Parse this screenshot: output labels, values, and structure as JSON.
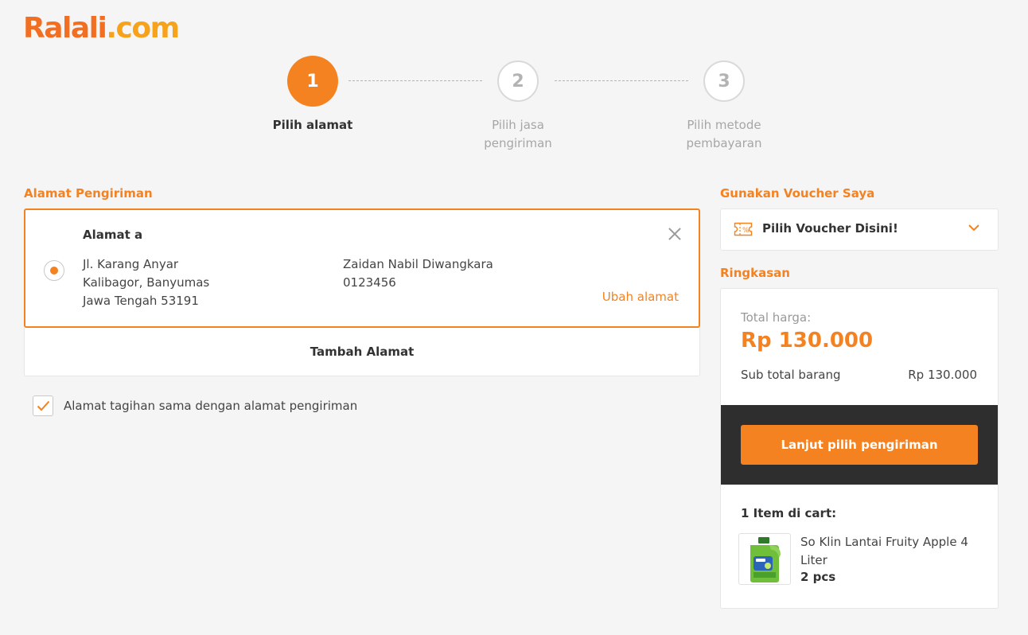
{
  "brand": {
    "name_main": "Ralali",
    "name_domain": ".com"
  },
  "stepper": {
    "steps": [
      {
        "number": "1",
        "label": "Pilih alamat"
      },
      {
        "number": "2",
        "label_line1": "Pilih jasa",
        "label_line2": "pengiriman"
      },
      {
        "number": "3",
        "label_line1": "Pilih metode",
        "label_line2": "pembayaran"
      }
    ],
    "active_step": 1
  },
  "shipping": {
    "section_title": "Alamat Pengiriman",
    "address": {
      "name": "Alamat a",
      "line1": "Jl. Karang Anyar",
      "line2": "Kalibagor, Banyumas",
      "line3": "Jawa Tengah 53191",
      "recipient": "Zaidan Nabil Diwangkara",
      "phone": "0123456",
      "edit_label": "Ubah alamat",
      "selected": true
    },
    "add_address_label": "Tambah Alamat",
    "billing_same_label": "Alamat tagihan sama dengan alamat pengiriman",
    "billing_same_checked": true
  },
  "voucher": {
    "section_title": "Gunakan Voucher Saya",
    "placeholder": "Pilih Voucher Disini!"
  },
  "summary": {
    "section_title": "Ringkasan",
    "total_label": "Total harga:",
    "total_value": "Rp 130.000",
    "subtotal_label": "Sub total barang",
    "subtotal_value": "Rp 130.000",
    "continue_label": "Lanjut pilih pengiriman",
    "cart_count_label": "1 Item di cart:",
    "items": [
      {
        "name": "So Klin Lantai Fruity Apple 4 Liter",
        "qty": "2 pcs"
      }
    ]
  },
  "colors": {
    "accent": "#f58220",
    "brand_red": "#f26f21",
    "brand_yellow": "#f7a21b",
    "dark_band": "#2e2e2e"
  },
  "icons": [
    "voucher-icon",
    "chevron-down-icon",
    "close-icon",
    "checkmark-icon",
    "radio-selected-icon"
  ]
}
